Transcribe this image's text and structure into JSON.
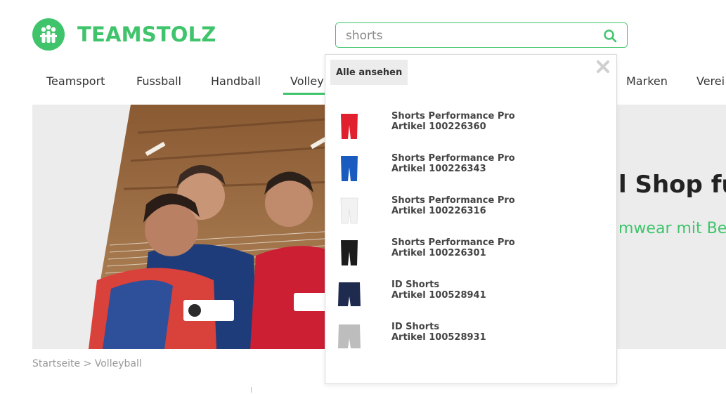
{
  "brand": {
    "name": "TEAMSTOLZ",
    "accent": "#3fc46b"
  },
  "search": {
    "value": "shorts",
    "placeholder": ""
  },
  "nav": {
    "items": [
      "Teamsport",
      "Fussball",
      "Handball",
      "Volley",
      "Marken",
      "Verei"
    ],
    "active": "Volley"
  },
  "hero": {
    "title": "l Shop fü",
    "subtitle": "mwear mit Be"
  },
  "breadcrumb": {
    "home": "Startseite",
    "separator": ">",
    "current": "Volleyball"
  },
  "dropdown": {
    "view_all_label": "Alle ansehen",
    "close_icon": "close-icon",
    "results": [
      {
        "name": "Shorts Performance Pro",
        "sku": "Artikel 100226360",
        "color": "#e0202e",
        "style": "tight"
      },
      {
        "name": "Shorts Performance Pro",
        "sku": "Artikel 100226343",
        "color": "#1a5bbf",
        "style": "tight"
      },
      {
        "name": "Shorts Performance Pro",
        "sku": "Artikel 100226316",
        "color": "#f2f2f2",
        "style": "tight"
      },
      {
        "name": "Shorts Performance Pro",
        "sku": "Artikel 100226301",
        "color": "#1c1c1c",
        "style": "tight"
      },
      {
        "name": "ID Shorts",
        "sku": "Artikel 100528941",
        "color": "#1f2a4f",
        "style": "loose"
      },
      {
        "name": "ID Shorts",
        "sku": "Artikel 100528931",
        "color": "#bdbdbd",
        "style": "loose"
      }
    ]
  }
}
